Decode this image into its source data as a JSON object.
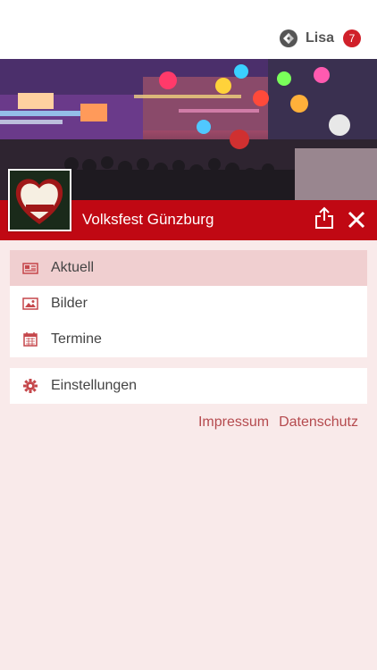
{
  "header": {
    "user_name": "Lisa",
    "notification_count": "7"
  },
  "hero": {
    "title": "Volksfest Günzburg",
    "logo_alt": "Herzlich Willkommen auf dem Günzburger Volksfest"
  },
  "menu": {
    "items": [
      {
        "label": "Aktuell",
        "icon": "newspaper-icon",
        "active": true
      },
      {
        "label": "Bilder",
        "icon": "image-icon",
        "active": false
      },
      {
        "label": "Termine",
        "icon": "calendar-icon",
        "active": false
      }
    ],
    "settings_label": "Einstellungen"
  },
  "footer": {
    "impressum": "Impressum",
    "datenschutz": "Datenschutz"
  },
  "colors": {
    "accent": "#c00813",
    "background": "#f9eaea",
    "active_item": "#f0cfd0",
    "link": "#b54a4e"
  }
}
